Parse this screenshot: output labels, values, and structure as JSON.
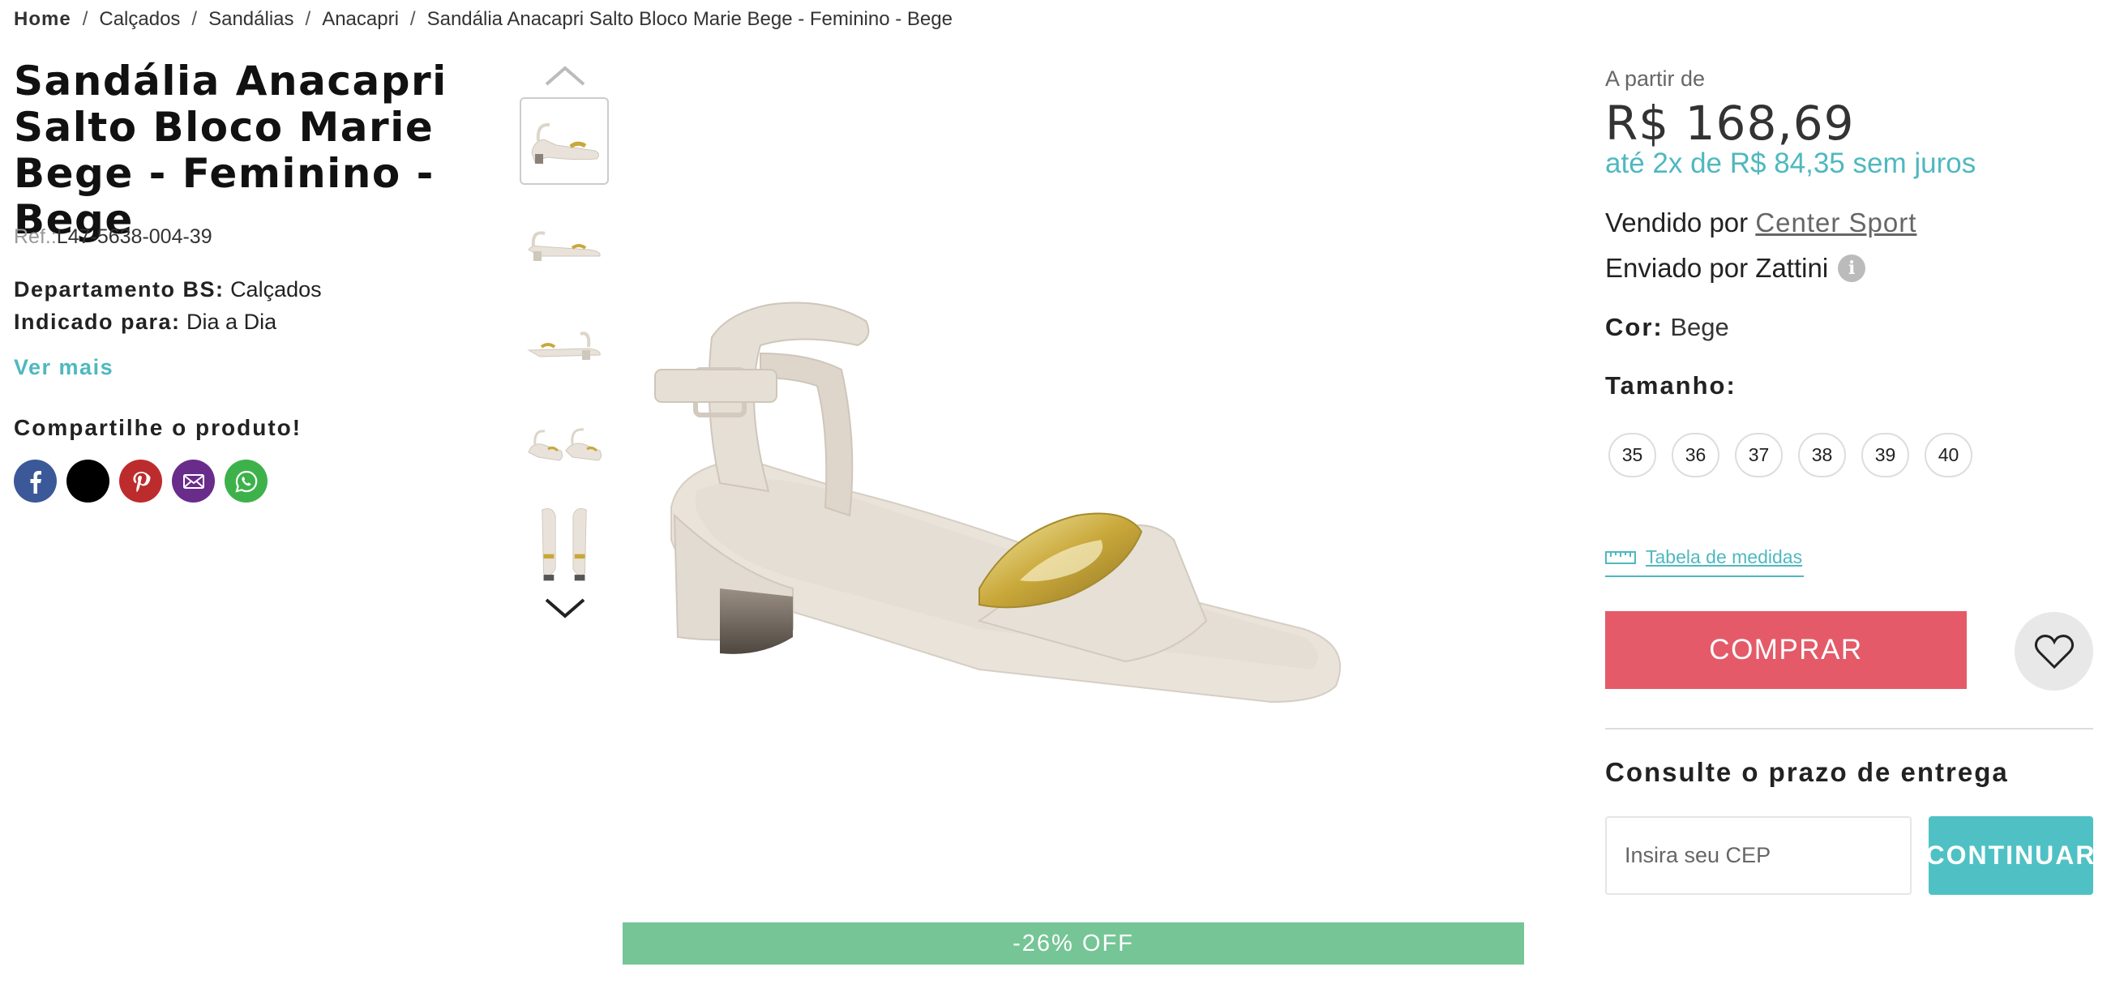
{
  "breadcrumb": {
    "home": "Home",
    "items": [
      "Calçados",
      "Sandálias",
      "Anacapri",
      "Sandália Anacapri Salto Bloco Marie Bege - Feminino - Bege"
    ],
    "separator": "/"
  },
  "product": {
    "title": "Sandália Anacapri Salto Bloco Marie Bege - Feminino - Bege",
    "ref_label": "Ref.:",
    "ref_value": "L47-5638-004-39",
    "attributes": [
      {
        "key": "Departamento BS:",
        "value": "Calçados"
      },
      {
        "key": "Indicado para:",
        "value": "Dia a Dia"
      }
    ],
    "ver_mais": "Ver mais",
    "discount_badge": "-26% OFF"
  },
  "share": {
    "title": "Compartilhe o produto!",
    "networks": [
      "facebook-icon",
      "x-twitter-icon",
      "pinterest-icon",
      "email-icon",
      "whatsapp-icon"
    ]
  },
  "pricing": {
    "from_label": "A partir de",
    "price": "R$ 168,69",
    "installments": "até 2x de R$ 84,35 sem juros"
  },
  "seller": {
    "sold_by_label": "Vendido por",
    "sold_by_name": "Center Sport",
    "shipped_by": "Enviado por Zattini"
  },
  "color": {
    "label": "Cor:",
    "value": "Bege"
  },
  "size": {
    "label": "Tamanho:",
    "options": [
      "35",
      "36",
      "37",
      "38",
      "39",
      "40"
    ]
  },
  "measure_table": "Tabela de medidas",
  "buy_button": "COMPRAR",
  "delivery": {
    "title": "Consulte o prazo de entrega",
    "placeholder": "Insira seu CEP",
    "button": "CONTINUAR"
  },
  "colors": {
    "accent": "#4fb8bf",
    "buy": "#e45a69",
    "discount": "#76c596",
    "continue": "#4fc1c4"
  }
}
